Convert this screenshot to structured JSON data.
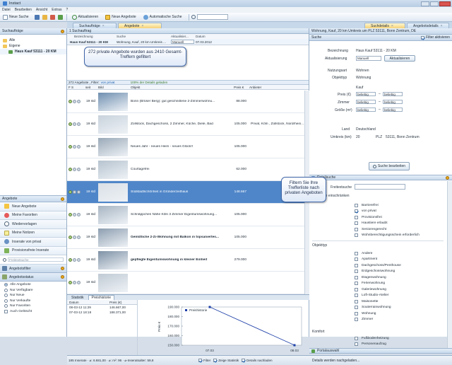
{
  "window": {
    "title": "Instact"
  },
  "menu": [
    "Datei",
    "Bearbeiten",
    "Ansicht",
    "Extras",
    "?"
  ],
  "toolbar": {
    "new_search": "Neue Suche",
    "refresh": "Aktualisieren",
    "new_offers": "Neue Angebote",
    "auto_search": "Automatische Suche"
  },
  "tabs": [
    {
      "label": "Suchaufträge"
    },
    {
      "label": "Angebote"
    }
  ],
  "right_tabs": [
    {
      "label": "Suchdetails"
    },
    {
      "label": "Angebotsdetails"
    }
  ],
  "left": {
    "search_orders_header": "Suchaufträge",
    "tree": [
      "Alle",
      "Eigene",
      "Haus Kauf 53111 - 20 KM"
    ],
    "offers_header": "Angebote",
    "nav": [
      "Neue Angebote",
      "Meine Favoriten",
      "Wiedervorlagen",
      "Meine Notizen",
      "Inserate von privat",
      "Provisionsfreie Inserate"
    ],
    "search_placeholder": "Freitextsuche",
    "filter_header": "Angebotsfilter",
    "status_header": "Angebotsstatus",
    "status": [
      "Alle Angebote",
      "Nur Verfügbare",
      "Nur Neue",
      "Nur Verkaufte",
      "Nur Favoriten",
      "Auch Gelöscht"
    ]
  },
  "center": {
    "header": "1 Suchauftrag",
    "cols": {
      "name": "Bezeichnung",
      "search": "Suche",
      "refresh": "Aktualisier...",
      "date": "Datum"
    },
    "order": {
      "name": "Haus Kauf 53111 - 20 KM",
      "search": "Wohnung, Kauf, 20 km Umkreis ...",
      "refresh": "Manuell",
      "date": "07.03.2012"
    },
    "bubble": "272 private Angebote wurden aus 2410 Gesamt-Treffern gefiltert",
    "filterbar": {
      "count": "272 Angebote , Filter:",
      "filter": "von privat",
      "status": "100% der Details geladen"
    },
    "table_cols": {
      "f": "F",
      "s": "S",
      "seit": "seit",
      "bild": "Bild",
      "objekt": "Objekt",
      "preis": "Preis €",
      "anbieter": "Anbieter"
    },
    "rows": [
      {
        "seit": "19 std",
        "objekt": "Bonn (Brüser Berg): gut geschnittene 2-Zimmerwohnu...",
        "preis": "88.000",
        "anbieter": ""
      },
      {
        "seit": "19 std",
        "objekt": "Zollstock, Dachgeschoss, 2 Zimmer, Küche, Diele, Bad",
        "preis": "105.000",
        "anbieter": "Privat, Köln , Zollstock, Nordrhein..."
      },
      {
        "seit": "19 std",
        "objekt": "Neues Jahr - neues Heim - neues Glück!!",
        "preis": "105.000",
        "anbieter": ""
      },
      {
        "seit": "19 std",
        "objekt": "Courtagefrei",
        "preis": "62.000",
        "anbieter": ""
      },
      {
        "seit": "19 std",
        "objekt": "Südstadtschönheit in Gründerzeithaus",
        "preis": "148.667",
        "anbieter": ""
      },
      {
        "seit": "19 std",
        "objekt": "Schnäppchen Nähe Köln 3 Zimmer Eigentumswohnung...",
        "preis": "105.000",
        "anbieter": ""
      },
      {
        "seit": "19 std",
        "objekt": "Gemütliche 2-Zi-Wohnung mit Balkon in topsaniertes...",
        "preis": "105.000",
        "anbieter": ""
      },
      {
        "seit": "19 std",
        "objekt": "gepflegte Eigentumswohnung in kleiner Einheit",
        "preis": "279.000",
        "anbieter": ""
      },
      {
        "seit": "19 std",
        "objekt": "",
        "preis": "",
        "anbieter": ""
      }
    ],
    "bottom_tabs": [
      "Statistik",
      "Preishistorie"
    ],
    "history_cols": {
      "date": "Datum",
      "price": "Preis (€)"
    },
    "history": [
      {
        "date": "08-03-12 11:29",
        "price": "146.667,00"
      },
      {
        "date": "07-03-12 18:18",
        "price": "188.371,00"
      }
    ],
    "status_bar": "185 Inserate · ⌀: 6.681,00 · ⌀: m²: 96 · ⌀-Inseratsalter: 59,8",
    "status_checks": [
      "Filter",
      "Zeige Statistik",
      "Details nachladen"
    ]
  },
  "chart_data": {
    "type": "line",
    "x": [
      "07.03",
      "08.03"
    ],
    "values": [
      190000,
      150000
    ],
    "series": [
      {
        "name": "Preishistorie",
        "values": [
          190000,
          150000
        ]
      }
    ],
    "ylabel": "Preis €",
    "yticks": [
      "190.000",
      "180.000",
      "170.000",
      "160.000",
      "150.000"
    ],
    "ylim": [
      150000,
      190000
    ],
    "legend": "top-left"
  },
  "right": {
    "header": "Wohnung, Kauf, 20 km Umkreis um PLZ 53111, Bonn Zentrum, DE",
    "search_label": "Suche",
    "filter_active": "Filter aktivieren",
    "fields": {
      "bez_label": "Bezeichnung",
      "bez": "Haus Kauf 53111 - 20 KM",
      "akt_label": "Aktualisierung",
      "akt": "Manuell",
      "akt_btn": "Aktualisieren",
      "nutz_label": "Nutzungsart",
      "nutz": "Wohnen",
      "obj_label": "Objekttyp",
      "obj": "Wohnung",
      "kauf": "Kauf",
      "preis_label": "Preis (€)",
      "zimmer_label": "Zimmer",
      "groesse_label": "Größe (m²)",
      "beliebig": "beliebig",
      "land_label": "Land",
      "land": "Deutschland",
      "umkreis_label": "Umkreis (km)",
      "umkreis": "20",
      "plz": "PLZ",
      "ort": "53111, Bonn Zentrum"
    },
    "search_btn": "Suche bearbeiten",
    "detail_header": "Detailsuche",
    "freitext_label": "Freitextsuche",
    "restrict_label": "Angebote einschränken",
    "restrict": [
      {
        "label": "Barrierefrei",
        "on": false
      },
      {
        "label": "von privat",
        "on": true
      },
      {
        "label": "Provisionsfrei",
        "on": false
      },
      {
        "label": "Haustiere erlaubt",
        "on": false
      },
      {
        "label": "Seniorengerecht",
        "on": false
      },
      {
        "label": "Wohnberechtigungsschein erforderlich",
        "on": false
      }
    ],
    "objtype_label": "Objekttyp",
    "objtypes": [
      "Andere",
      "Apartment",
      "Dachgeschoss/Penthouse",
      "Erdgeschosswohnung",
      "Etagenwohnung",
      "Ferienwohnung",
      "Galeriewohnung",
      "Loft-Studio-Atelier",
      "Maisonette",
      "Souterrainwohnung",
      "Wohnung",
      "Zimmer"
    ],
    "komfort_label": "Komfort",
    "komfort": [
      "Fußbodenheizung",
      "Personenaufzug"
    ],
    "portal_header": "Portalauswahl",
    "status": "Details werden nachgeladen...",
    "bubble": "Filtern Sie Ihre Trefferliste nach privaten Angeboten"
  },
  "colors": {
    "accent": "#f4d27a",
    "selection": "#4f86c9",
    "header": "#c8d9ec"
  }
}
